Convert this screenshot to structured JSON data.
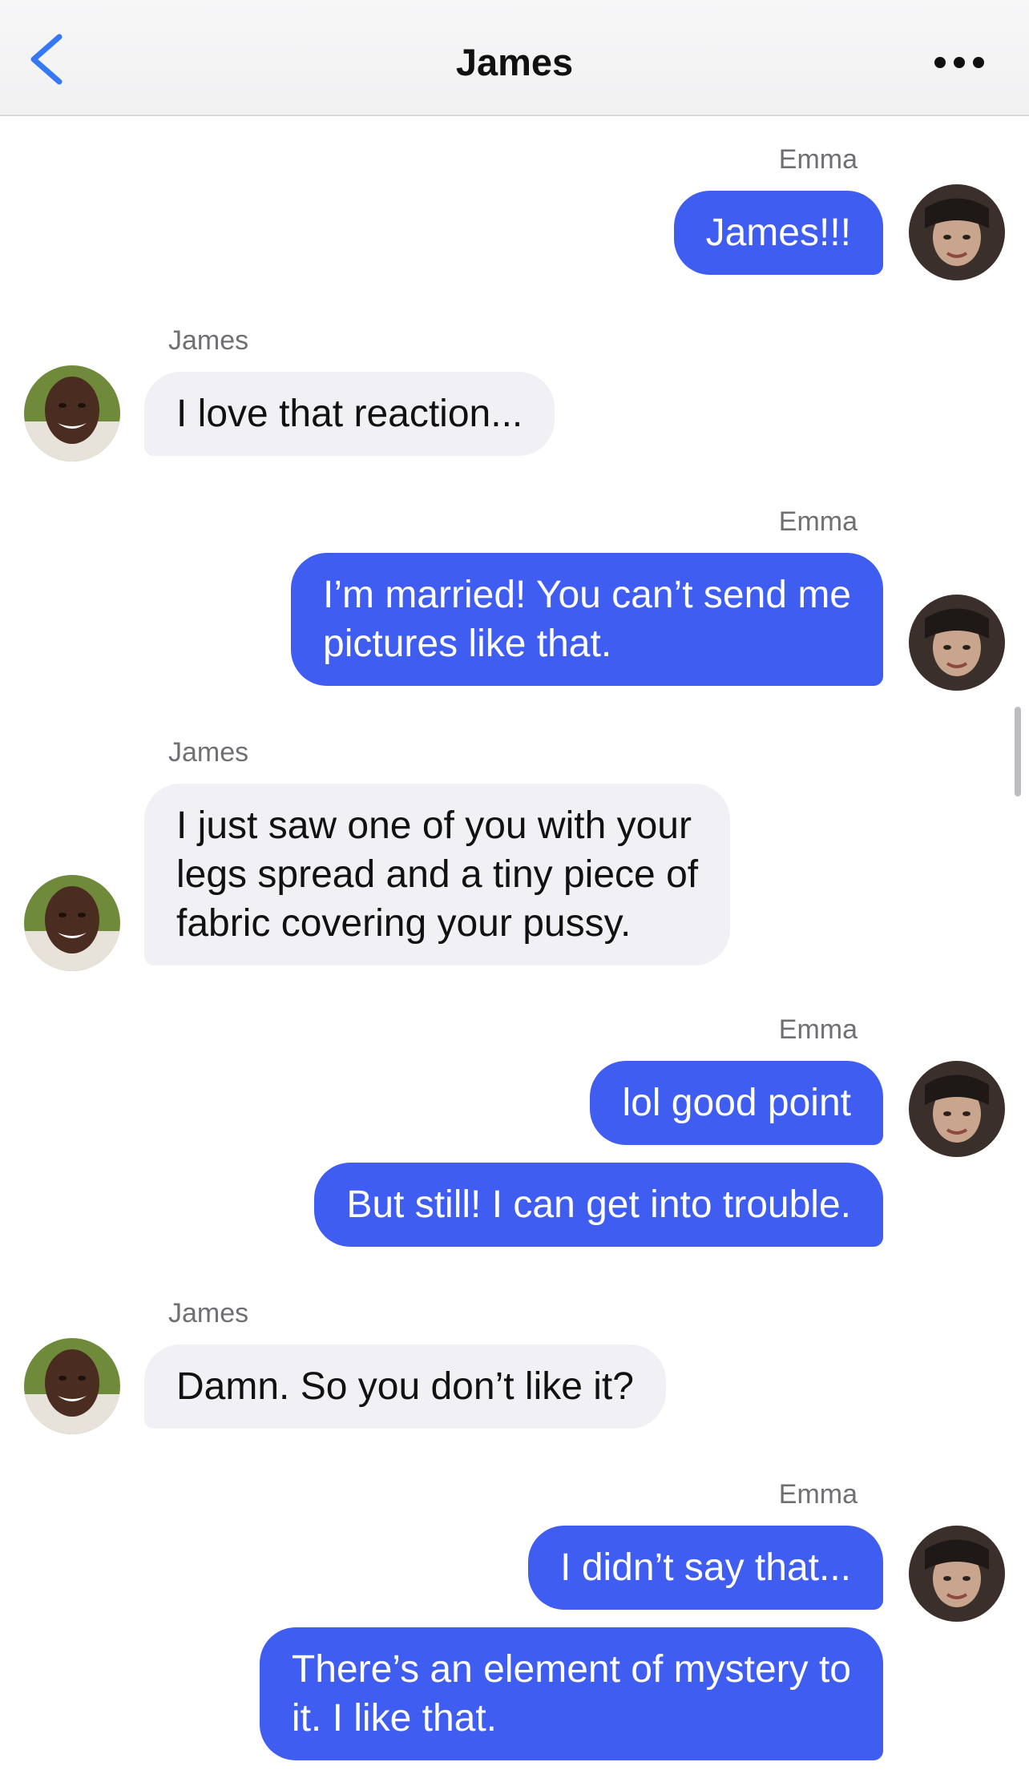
{
  "header": {
    "title": "James",
    "back_icon": "chevron-left-icon",
    "more_icon": "more-horizontal-icon",
    "accent_color": "#3478f6"
  },
  "colors": {
    "outgoing_bubble": "#3f5df0",
    "incoming_bubble": "#f1f1f5"
  },
  "messages": [
    {
      "sender": "Emma",
      "text": "James!!!"
    },
    {
      "sender": "James",
      "text": "I love that reaction..."
    },
    {
      "sender": "Emma",
      "text": "I’m married! You can’t send me\npictures like that."
    },
    {
      "sender": "James",
      "text": "I just saw one of you with your\nlegs spread and a tiny piece of\nfabric covering your pussy."
    },
    {
      "sender": "Emma",
      "text": "lol good point"
    },
    {
      "sender": "",
      "text": "But still! I can get into trouble."
    },
    {
      "sender": "James",
      "text": "Damn. So you don’t like it?"
    },
    {
      "sender": "Emma",
      "text": "I didn’t say that..."
    },
    {
      "sender": "",
      "text": "There’s an element of mystery to\nit. I like that."
    }
  ]
}
